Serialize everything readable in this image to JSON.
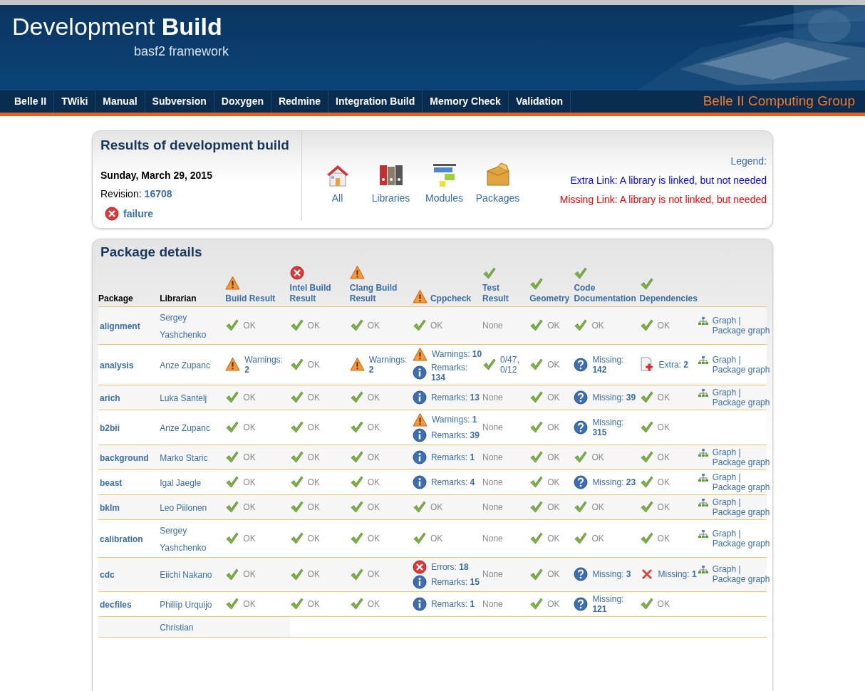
{
  "header": {
    "title": "Development **Build**",
    "subtitle": "basf2 framework"
  },
  "nav": {
    "items": [
      "Belle II",
      "TWiki",
      "Manual",
      "Subversion",
      "Doxygen",
      "Redmine",
      "Integration Build",
      "Memory Check",
      "Validation"
    ],
    "group": "Belle II Computing Group"
  },
  "summary": {
    "title": "Results of development build",
    "date": "Sunday, March 29, 2015",
    "revision_label": "Revision:",
    "revision": "16708",
    "status": {
      "kind": "error",
      "text": "failure"
    },
    "views": [
      {
        "kind": "house",
        "label": "All"
      },
      {
        "kind": "binders",
        "label": "Libraries"
      },
      {
        "kind": "modules",
        "label": "Modules"
      },
      {
        "kind": "box",
        "label": "Packages"
      }
    ],
    "legend": {
      "title": "Legend:",
      "items": [
        {
          "text": "Extra Link: A library is linked, but not needed",
          "color": "#0000ff"
        },
        {
          "text": "Missing Link: A library is not linked, but needed",
          "color": "#ff0000"
        }
      ]
    }
  },
  "details": {
    "title": "Package details",
    "columns": [
      {
        "label": "Package"
      },
      {
        "label": "Librarian"
      },
      {
        "label": "Build Result",
        "kind": "warning"
      },
      {
        "label": "Intel Build Result",
        "kind": "error"
      },
      {
        "label": "Clang Build Result",
        "kind": "warning"
      },
      {
        "label": "Cppcheck",
        "kind": "warning"
      },
      {
        "label": "Test Result",
        "kind": "ok"
      },
      {
        "label": "Geometry",
        "kind": "ok"
      },
      {
        "label": "Code Documentation",
        "kind": "ok"
      },
      {
        "label": "Dependencies",
        "kind": "ok"
      }
    ],
    "rows": [
      {
        "package": "alignment",
        "librarian": "Sergey Yashchenko",
        "cells": [
          [
            {
              "kind": "ok",
              "text": "OK"
            }
          ],
          [
            {
              "kind": "ok",
              "text": "OK"
            }
          ],
          [
            {
              "kind": "ok",
              "text": "OK"
            }
          ],
          [
            {
              "kind": "ok",
              "text": "OK"
            }
          ],
          [
            {
              "text": "None"
            }
          ],
          [
            {
              "kind": "ok",
              "text": "OK"
            }
          ],
          [
            {
              "kind": "ok",
              "text": "OK"
            }
          ],
          [
            {
              "kind": "ok",
              "text": "OK"
            }
          ]
        ],
        "links": {
          "graph": "Graph",
          "separator": "|",
          "package_graph": "Package graph"
        }
      },
      {
        "package": "analysis",
        "librarian": "Anze Zupanc",
        "cells": [
          [
            {
              "kind": "warning",
              "text": "Warnings:",
              "count": "2"
            }
          ],
          [
            {
              "kind": "ok",
              "text": "OK"
            }
          ],
          [
            {
              "kind": "warning",
              "text": "Warnings:",
              "count": "2"
            }
          ],
          [
            {
              "kind": "warning",
              "text": "Warnings:",
              "count": "10"
            },
            {
              "kind": "info",
              "text": "Remarks:",
              "count": "134"
            }
          ],
          [
            {
              "kind": "ok",
              "text": "0/47, 0/12"
            }
          ],
          [
            {
              "kind": "ok",
              "text": "OK"
            }
          ],
          [
            {
              "kind": "question",
              "text": "Missing:",
              "count": "142"
            }
          ],
          [
            {
              "kind": "extra",
              "text": "Extra:",
              "count": "2"
            }
          ]
        ],
        "links": {
          "graph": "Graph",
          "separator": "|",
          "package_graph": "Package graph"
        }
      },
      {
        "package": "arich",
        "librarian": "Luka Santelj",
        "cells": [
          [
            {
              "kind": "ok",
              "text": "OK"
            }
          ],
          [
            {
              "kind": "ok",
              "text": "OK"
            }
          ],
          [
            {
              "kind": "ok",
              "text": "OK"
            }
          ],
          [
            {
              "kind": "info",
              "text": "Remarks:",
              "count": "13"
            }
          ],
          [
            {
              "text": "None"
            }
          ],
          [
            {
              "kind": "ok",
              "text": "OK"
            }
          ],
          [
            {
              "kind": "question",
              "text": "Missing:",
              "count": "39"
            }
          ],
          [
            {
              "kind": "ok",
              "text": "OK"
            }
          ]
        ],
        "links": {
          "graph": "Graph",
          "separator": "|",
          "package_graph": "Package graph"
        }
      },
      {
        "package": "b2bii",
        "librarian": "Anze Zupanc",
        "cells": [
          [
            {
              "kind": "ok",
              "text": "OK"
            }
          ],
          [
            {
              "kind": "ok",
              "text": "OK"
            }
          ],
          [
            {
              "kind": "ok",
              "text": "OK"
            }
          ],
          [
            {
              "kind": "warning",
              "text": "Warnings:",
              "count": "1"
            },
            {
              "kind": "info",
              "text": "Remarks:",
              "count": "39"
            }
          ],
          [
            {
              "text": "None"
            }
          ],
          [
            {
              "kind": "ok",
              "text": "OK"
            }
          ],
          [
            {
              "kind": "question",
              "text": "Missing:",
              "count": "315"
            }
          ],
          [
            {
              "kind": "ok",
              "text": "OK"
            }
          ]
        ]
      },
      {
        "package": "background",
        "librarian": "Marko Staric",
        "cells": [
          [
            {
              "kind": "ok",
              "text": "OK"
            }
          ],
          [
            {
              "kind": "ok",
              "text": "OK"
            }
          ],
          [
            {
              "kind": "ok",
              "text": "OK"
            }
          ],
          [
            {
              "kind": "info",
              "text": "Remarks:",
              "count": "1"
            }
          ],
          [
            {
              "text": "None"
            }
          ],
          [
            {
              "kind": "ok",
              "text": "OK"
            }
          ],
          [
            {
              "kind": "ok",
              "text": "OK"
            }
          ],
          [
            {
              "kind": "ok",
              "text": "OK"
            }
          ]
        ],
        "links": {
          "graph": "Graph",
          "separator": "|",
          "package_graph": "Package graph"
        }
      },
      {
        "package": "beast",
        "librarian": "Igal Jaegle",
        "cells": [
          [
            {
              "kind": "ok",
              "text": "OK"
            }
          ],
          [
            {
              "kind": "ok",
              "text": "OK"
            }
          ],
          [
            {
              "kind": "ok",
              "text": "OK"
            }
          ],
          [
            {
              "kind": "info",
              "text": "Remarks:",
              "count": "4"
            }
          ],
          [
            {
              "text": "None"
            }
          ],
          [
            {
              "kind": "ok",
              "text": "OK"
            }
          ],
          [
            {
              "kind": "question",
              "text": "Missing:",
              "count": "23"
            }
          ],
          [
            {
              "kind": "ok",
              "text": "OK"
            }
          ]
        ],
        "links": {
          "graph": "Graph",
          "separator": "|",
          "package_graph": "Package graph"
        }
      },
      {
        "package": "bklm",
        "librarian": "Leo Piilonen",
        "cells": [
          [
            {
              "kind": "ok",
              "text": "OK"
            }
          ],
          [
            {
              "kind": "ok",
              "text": "OK"
            }
          ],
          [
            {
              "kind": "ok",
              "text": "OK"
            }
          ],
          [
            {
              "kind": "ok",
              "text": "OK"
            }
          ],
          [
            {
              "text": "None"
            }
          ],
          [
            {
              "kind": "ok",
              "text": "OK"
            }
          ],
          [
            {
              "kind": "ok",
              "text": "OK"
            }
          ],
          [
            {
              "kind": "ok",
              "text": "OK"
            }
          ]
        ],
        "links": {
          "graph": "Graph",
          "separator": "|",
          "package_graph": "Package graph"
        }
      },
      {
        "package": "calibration",
        "librarian": "Sergey Yashchenko",
        "cells": [
          [
            {
              "kind": "ok",
              "text": "OK"
            }
          ],
          [
            {
              "kind": "ok",
              "text": "OK"
            }
          ],
          [
            {
              "kind": "ok",
              "text": "OK"
            }
          ],
          [
            {
              "kind": "ok",
              "text": "OK"
            }
          ],
          [
            {
              "text": "None"
            }
          ],
          [
            {
              "kind": "ok",
              "text": "OK"
            }
          ],
          [
            {
              "kind": "ok",
              "text": "OK"
            }
          ],
          [
            {
              "kind": "ok",
              "text": "OK"
            }
          ]
        ],
        "links": {
          "graph": "Graph",
          "separator": "|",
          "package_graph": "Package graph"
        }
      },
      {
        "package": "cdc",
        "librarian": "Eiichi Nakano",
        "cells": [
          [
            {
              "kind": "ok",
              "text": "OK"
            }
          ],
          [
            {
              "kind": "ok",
              "text": "OK"
            }
          ],
          [
            {
              "kind": "ok",
              "text": "OK"
            }
          ],
          [
            {
              "kind": "error",
              "text": "Errors:",
              "count": "18"
            },
            {
              "kind": "info",
              "text": "Remarks:",
              "count": "15"
            }
          ],
          [
            {
              "text": "None"
            }
          ],
          [
            {
              "kind": "ok",
              "text": "OK"
            }
          ],
          [
            {
              "kind": "question",
              "text": "Missing:",
              "count": "3"
            }
          ],
          [
            {
              "kind": "cross",
              "text": "Missing:",
              "count": "1"
            }
          ]
        ],
        "links": {
          "graph": "Graph",
          "separator": "|",
          "package_graph": "Package graph"
        }
      },
      {
        "package": "decfiles",
        "librarian": "Phillip Urquijo",
        "cells": [
          [
            {
              "kind": "ok",
              "text": "OK"
            }
          ],
          [
            {
              "kind": "ok",
              "text": "OK"
            }
          ],
          [
            {
              "kind": "ok",
              "text": "OK"
            }
          ],
          [
            {
              "kind": "info",
              "text": "Remarks:",
              "count": "1"
            }
          ],
          [
            {
              "text": "None"
            }
          ],
          [
            {
              "kind": "ok",
              "text": "OK"
            }
          ],
          [
            {
              "kind": "question",
              "text": "Missing:",
              "count": "121"
            }
          ],
          [
            {
              "kind": "ok",
              "text": "OK"
            }
          ]
        ]
      },
      {
        "librarian": "Christian"
      }
    ]
  }
}
